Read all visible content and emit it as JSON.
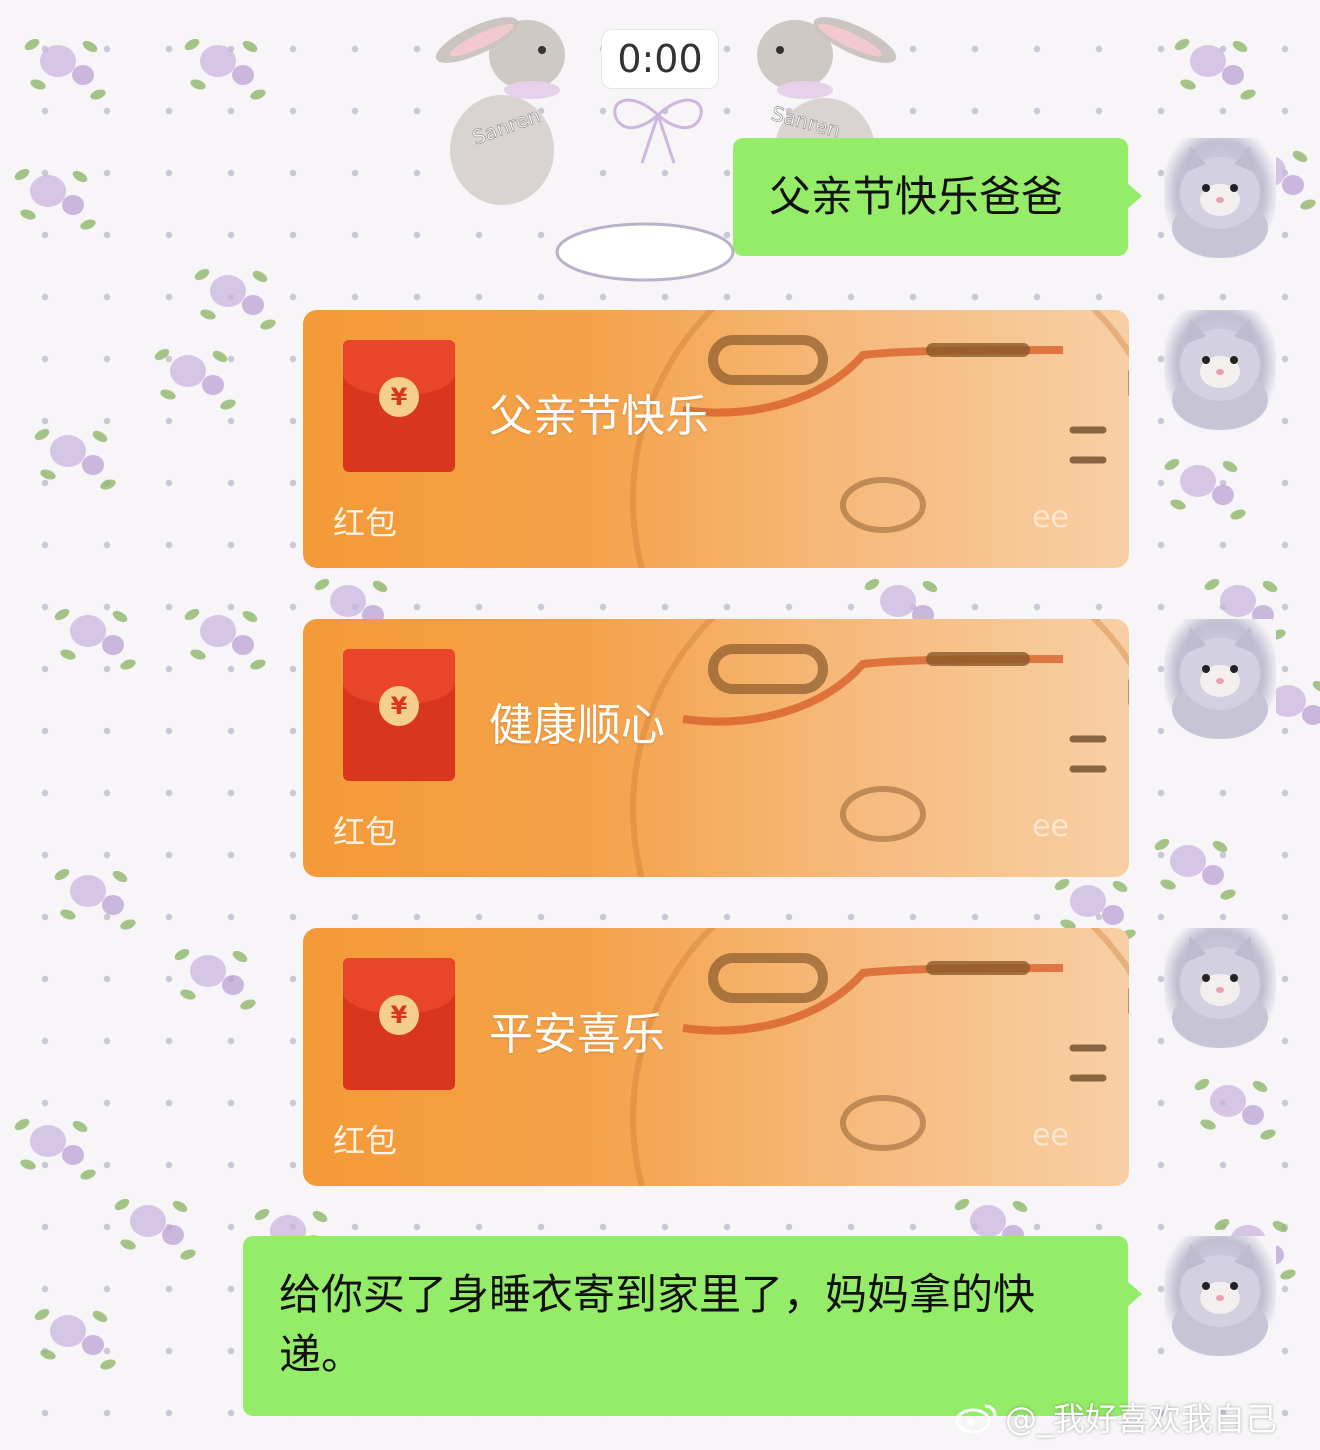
{
  "chat": {
    "timestamp": "0:00",
    "messages": {
      "m1": "父亲节快乐爸爸",
      "m5": "给你买了身睡衣寄到家里了，妈妈拿的快递。"
    },
    "red_packets": [
      {
        "title": "父亲节快乐",
        "label": "红包",
        "coin": "¥",
        "sticker_text": "ee"
      },
      {
        "title": "健康顺心",
        "label": "红包",
        "coin": "¥",
        "sticker_text": "ee"
      },
      {
        "title": "平安喜乐",
        "label": "红包",
        "coin": "¥",
        "sticker_text": "ee"
      }
    ]
  },
  "wallpaper": {
    "stamp_text": "Sanren"
  },
  "watermark": {
    "text": "@_我好喜欢我自己"
  },
  "colors": {
    "bubble_green": "#95ec69",
    "packet_orange": "#f49a37",
    "envelope_red": "#d8371e",
    "background": "#f7f5f7"
  }
}
